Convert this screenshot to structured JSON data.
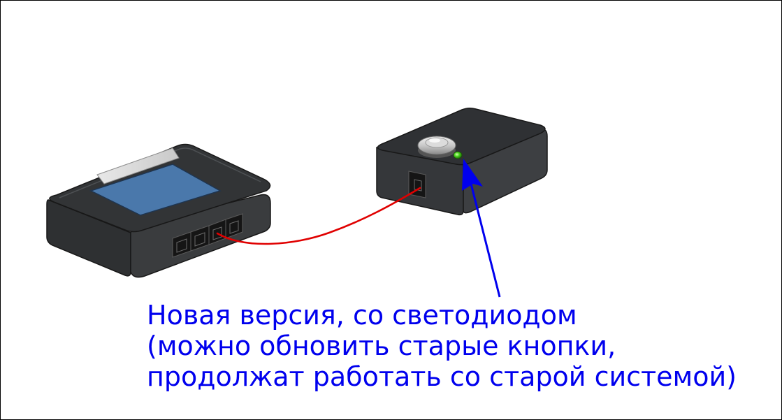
{
  "caption": {
    "lines": [
      "Новая версия, со светодиодом",
      "(можно обновить старые кнопки,",
      "продолжат работать со старой системой)"
    ]
  },
  "colors": {
    "cable": "#e00000",
    "arrow": "#0000ee",
    "screen": "#4a78ab",
    "led": "#44d11a",
    "device_body": "#3b3d3f",
    "device_top": "#303234"
  }
}
